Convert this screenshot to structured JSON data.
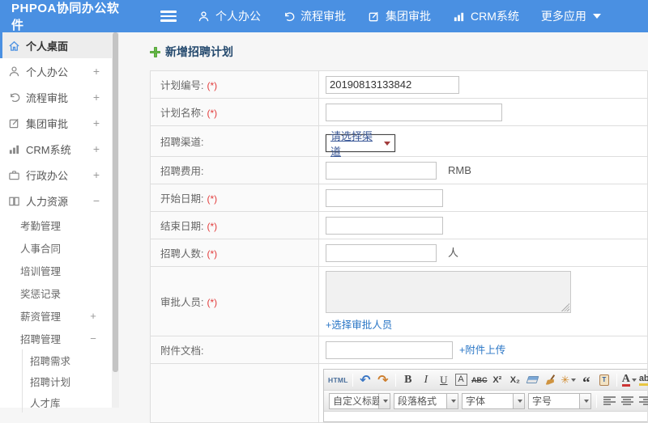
{
  "header": {
    "logo": "PHPOA协同办公软件",
    "nav": [
      {
        "label": "个人办公"
      },
      {
        "label": "流程审批"
      },
      {
        "label": "集团审批"
      },
      {
        "label": "CRM系统"
      },
      {
        "label": "更多应用"
      }
    ]
  },
  "sidebar": {
    "items": [
      {
        "label": "个人桌面",
        "toggle": ""
      },
      {
        "label": "个人办公",
        "toggle": "+"
      },
      {
        "label": "流程审批",
        "toggle": "+"
      },
      {
        "label": "集团审批",
        "toggle": "+"
      },
      {
        "label": "CRM系统",
        "toggle": "+"
      },
      {
        "label": "行政办公",
        "toggle": "+"
      },
      {
        "label": "人力资源",
        "toggle": "−"
      },
      {
        "label": "考勤管理",
        "toggle": ""
      },
      {
        "label": "人事合同",
        "toggle": ""
      },
      {
        "label": "培训管理",
        "toggle": ""
      },
      {
        "label": "奖惩记录",
        "toggle": ""
      },
      {
        "label": "薪资管理",
        "toggle": "+"
      },
      {
        "label": "招聘管理",
        "toggle": "−"
      },
      {
        "label": "招聘需求",
        "toggle": ""
      },
      {
        "label": "招聘计划",
        "toggle": ""
      },
      {
        "label": "人才库",
        "toggle": ""
      }
    ]
  },
  "main": {
    "title": "新增招聘计划",
    "form": {
      "rows": [
        {
          "label": "计划编号:",
          "required": "(*)",
          "value": "20190813133842"
        },
        {
          "label": "计划名称:",
          "required": "(*)"
        },
        {
          "label": "招聘渠道:",
          "select_value": "请选择渠道"
        },
        {
          "label": "招聘费用:",
          "suffix": "RMB"
        },
        {
          "label": "开始日期:",
          "required": "(*)"
        },
        {
          "label": "结束日期:",
          "required": "(*)"
        },
        {
          "label": "招聘人数:",
          "required": "(*)",
          "suffix": "人"
        },
        {
          "label": "审批人员:",
          "required": "(*)",
          "link": "+选择审批人员"
        },
        {
          "label": "附件文档:",
          "link": "+附件上传"
        }
      ]
    },
    "editor": {
      "source_button": "HTML",
      "bold": "B",
      "italic": "I",
      "underline": "U",
      "auto_typeset": "A",
      "strike": "ABC",
      "superscript": "X²",
      "subscript": "X₂",
      "quote": "“",
      "font_color": "A",
      "highlight": "ab",
      "selects": [
        {
          "label": "自定义标题"
        },
        {
          "label": "段落格式"
        },
        {
          "label": "字体"
        },
        {
          "label": "字号"
        }
      ]
    }
  },
  "colors": {
    "header_blue": "#4a90e2",
    "link_blue": "#2a76c6",
    "required_red": "#e23c3c",
    "title_navy": "#254a6e",
    "plus_green": "#6abf4b"
  }
}
